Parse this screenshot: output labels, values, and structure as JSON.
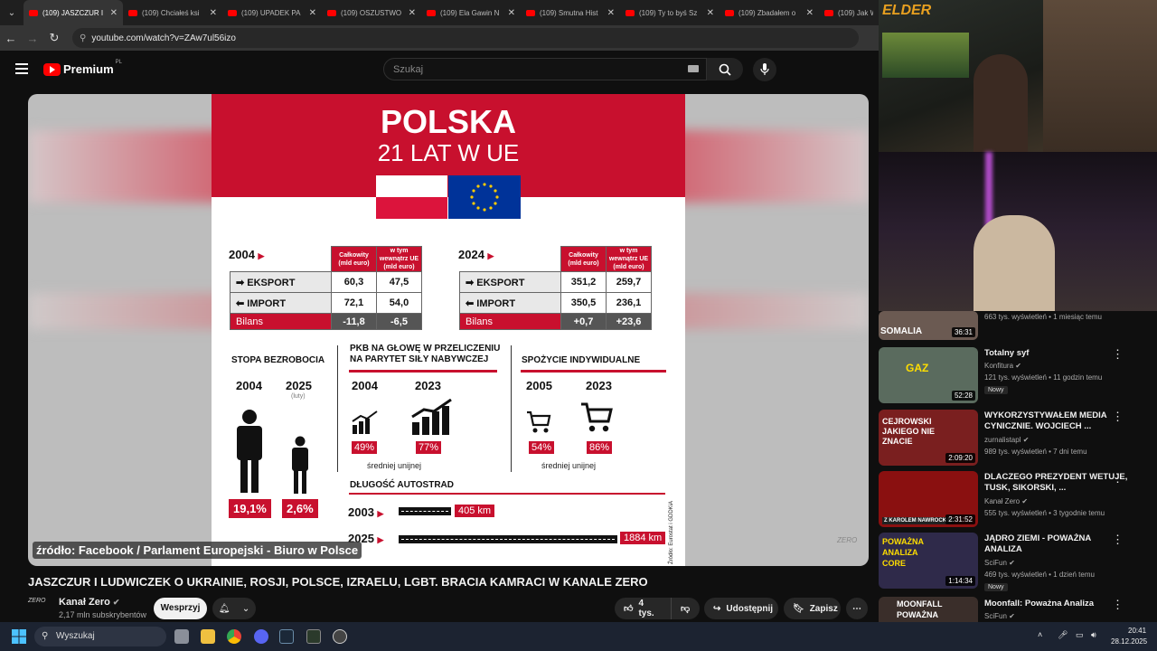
{
  "tabs": [
    {
      "title": "(109) JASZCZUR I",
      "active": true
    },
    {
      "title": "(109) Chciałeś ksi"
    },
    {
      "title": "(109) UPADEK PA"
    },
    {
      "title": "(109) OSZUSTWO"
    },
    {
      "title": "(109) Ela Gawin N"
    },
    {
      "title": "(109) Smutna Hist"
    },
    {
      "title": "(109) Ty to byś Sz"
    },
    {
      "title": "(109) Zbadałem o"
    },
    {
      "title": "(109) Jak W"
    }
  ],
  "url": "youtube.com/watch?v=ZAw7ul56izo",
  "header": {
    "logo": "Premium",
    "region": "PL",
    "search_placeholder": "Szukaj"
  },
  "slide": {
    "title": "POLSKA",
    "subtitle": "21 LAT W UE",
    "t2004": {
      "year": "2004",
      "col1": "Całkowity (mld euro)",
      "col2": "w tym wewnątrz UE (mld euro)",
      "rows": [
        {
          "label": "EKSPORT",
          "a": "60,3",
          "b": "47,5"
        },
        {
          "label": "IMPORT",
          "a": "72,1",
          "b": "54,0"
        }
      ],
      "bilans": {
        "label": "Bilans",
        "a": "-11,8",
        "b": "-6,5"
      }
    },
    "t2024": {
      "year": "2024",
      "col1": "Całkowity (mld euro)",
      "col2": "w tym wewnątrz UE (mld euro)",
      "rows": [
        {
          "label": "EKSPORT",
          "a": "351,2",
          "b": "259,7"
        },
        {
          "label": "IMPORT",
          "a": "350,5",
          "b": "236,1"
        }
      ],
      "bilans": {
        "label": "Bilans",
        "a": "+0,7",
        "b": "+23,6"
      }
    },
    "unemployment": {
      "title": "STOPA BEZROBOCIA",
      "y1": "2004",
      "y2": "2025",
      "y2_note": "(luty)",
      "v1": "19,1%",
      "v2": "2,6%"
    },
    "gdp": {
      "title": "PKB NA GŁOWĘ W PRZELICZENIU NA PARYTET SIŁY NABYWCZEJ",
      "y1": "2004",
      "y2": "2023",
      "v1": "49%",
      "v2": "77%",
      "note": "średniej unijnej"
    },
    "consumption": {
      "title": "SPOŻYCIE INDYWIDUALNE",
      "y1": "2005",
      "y2": "2023",
      "v1": "54%",
      "v2": "86%",
      "note": "średniej unijnej"
    },
    "roads": {
      "title": "DŁUGOŚĆ AUTOSTRAD",
      "y1": "2003",
      "v1": "405 km",
      "y2": "2025",
      "v2": "1884 km"
    },
    "source": "Źródło: Eurostat i GDDKiA"
  },
  "caption": "źródło: Facebook / Parlament Europejski - Biuro w Polsce",
  "watermark": "ZERO",
  "video": {
    "title": "JASZCZUR I LUDWICZEK O UKRAINIE, ROSJI, POLSCE, IZRAELU, LGBT. BRACIA KAMRACI W KANALE ZERO",
    "channel": "Kanał Zero",
    "subscribers": "2,17 mln subskrybentów",
    "support": "Wesprzyj",
    "likes": "4 tys.",
    "share": "Udostępnij",
    "save": "Zapisz"
  },
  "sidebar": [
    {
      "thumb_text": "SOMALIA",
      "duration": "36:31",
      "title": "",
      "channel": "",
      "meta": "663 tys. wyświetleń • 1 miesiąc temu",
      "thumb_color": "#6b5a52"
    },
    {
      "thumb_text": "GAZ",
      "duration": "52:28",
      "title": "Totalny syf",
      "channel": "Konfitura",
      "meta": "121 tys. wyświetleń • 11 godzin temu",
      "badge": "Nowy",
      "thumb_color": "#5a6b5e"
    },
    {
      "thumb_text": "CEJROWSKI JAKIEGO NIE ZNACIE",
      "duration": "2:09:20",
      "title": "WYKORZYSTYWAŁEM MEDIA CYNICZNIE. WOJCIECH ...",
      "channel": "zurnalistapl",
      "meta": "989 tys. wyświetleń • 7 dni temu",
      "thumb_color": "#7a1f1f"
    },
    {
      "thumb_text": "Z KAROLEM NAWROCKIM",
      "duration": "2:31:52",
      "title": "DLACZEGO PREZYDENT WETUJE, TUSK, SIKORSKI, ...",
      "channel": "Kanał Zero",
      "meta": "555 tys. wyświetleń • 3 tygodnie temu",
      "thumb_color": "#8a1010"
    },
    {
      "thumb_text": "POWAŻNA ANALIZA CORE",
      "duration": "1:14:34",
      "title": "JĄDRO ZIEMI - POWAŻNA ANALIZA",
      "channel": "SciFun",
      "meta": "469 tys. wyświetleń • 1 dzień temu",
      "badge": "Nowy",
      "thumb_color": "#2f2a4a"
    },
    {
      "thumb_text": "MOONFALL POWAŻNA",
      "duration": "",
      "title": "Moonfall: Poważna Analiza",
      "channel": "SciFun",
      "meta": "",
      "thumb_color": "#3a2e2a"
    }
  ],
  "taskbar": {
    "search": "Wyszukaj",
    "time": "20:41",
    "date": "28.12.2025"
  },
  "overlay_logo": "ELDER"
}
